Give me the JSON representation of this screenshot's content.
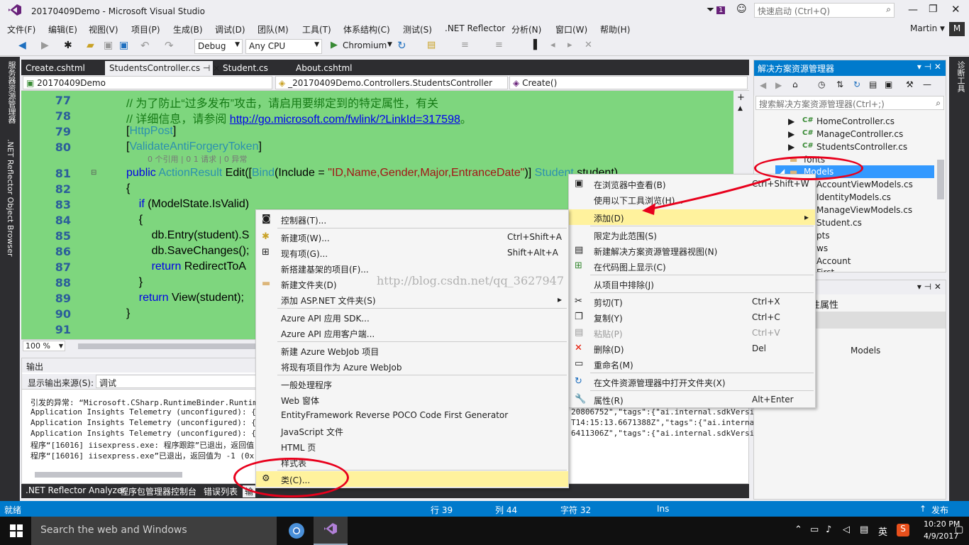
{
  "window": {
    "title": "20170409Demo - Microsoft Visual Studio",
    "notif_count": "1",
    "quick_launch": "快速启动 (Ctrl+Q)",
    "user": "Martin",
    "user_initial": "M"
  },
  "menu": [
    "文件(F)",
    "编辑(E)",
    "视图(V)",
    "项目(P)",
    "生成(B)",
    "调试(D)",
    "团队(M)",
    "工具(T)",
    "体系结构(C)",
    "测试(S)",
    ".NET Reflector",
    "分析(N)",
    "窗口(W)",
    "帮助(H)"
  ],
  "toolbar": {
    "config": "Debug",
    "platform": "Any CPU",
    "run": "Chromium"
  },
  "left_strip": [
    "服务器资源管理器",
    ".NET Reflector Object Browser"
  ],
  "right_strip": [
    "诊断工具"
  ],
  "tabs": [
    "Create.cshtml",
    "StudentsController.cs",
    "Student.cs",
    "About.cshtml"
  ],
  "tab_pin": "⊣ ×",
  "nav": {
    "project": "20170409Demo",
    "class": "_20170409Demo.Controllers.StudentsController",
    "member": "Create()"
  },
  "code": {
    "lines": [
      {
        "n": "77",
        "a": "// 为了防止“过多发布”攻击，请启用要绑定到的特定属性，有关"
      },
      {
        "n": "78",
        "a": "// 详细信息，请参阅 ",
        "link": "http://go.microsoft.com/fwlink/?LinkId=317598",
        "b": "。"
      },
      {
        "n": "79",
        "attr": "HttpPost"
      },
      {
        "n": "80",
        "attr": "ValidateAntiForgeryToken"
      },
      {
        "n": "81"
      },
      {
        "n": "82",
        "a": "{"
      },
      {
        "n": "83"
      },
      {
        "n": "84",
        "a": "    {"
      },
      {
        "n": "85",
        "a": "        db.Entry(student).S"
      },
      {
        "n": "86",
        "a": "        db.SaveChanges();"
      },
      {
        "n": "87"
      },
      {
        "n": "88",
        "a": "    }"
      },
      {
        "n": "89"
      },
      {
        "n": "90",
        "a": "}"
      },
      {
        "n": "91",
        "a": ""
      }
    ],
    "lens": "0 个引用 | 0 1 请求 | 0 异常",
    "l81_public": "public ",
    "l81_type": "ActionResult",
    "l81_rest": " Edit([",
    "l81_bind": "Bind",
    "l81_inc": "(Include = ",
    "l81_str": "\"ID,Name,Gender,Major,EntranceDate\"",
    "l81_end": ")] ",
    "l81_stype": "Student",
    "l81_arg": " student)",
    "l83_if": "if",
    "l83_rest": " (ModelState.IsValid)",
    "l87_ret": "return",
    "l87_rest": " RedirectToA",
    "l89_ret": "return",
    "l89_rest": " View(student);",
    "brackets": [
      "[",
      "]",
      "[",
      "]"
    ]
  },
  "zoom": "100 %",
  "output": {
    "title": "输出",
    "source_label": "显示输出来源(S):",
    "source_value": "调试",
    "lines": [
      "引发的异常: “Microsoft.CSharp.RuntimeBinder.RuntimeBi",
      "Application Insights Telemetry (unconfigured): {\"name",
      "Application Insights Telemetry (unconfigured): {\"name",
      "Application Insights Telemetry (unconfigured): {\"name",
      "程序“[16016] iisexpress.exe: 程序跟踪”已退出，返回值",
      "程序“[16016] iisexpress.exe”已退出，返回值为 -1 (0x"
    ],
    "right_lines": [
      "20806752\",\"tags\":{\"ai.internal.sdkVersi",
      "T14:15:13.6671388Z\",\"tags\":{\"ai.internal",
      "6411306Z\",\"tags\":{\"ai.internal.sdkVersi"
    ]
  },
  "bottom_tabs": [
    ".NET Reflector Analyzer",
    "程序包管理器控制台",
    "错误列表",
    "输"
  ],
  "solution": {
    "title": "解决方案资源管理器",
    "search": "搜索解决方案资源管理器(Ctrl+;)",
    "items": [
      {
        "label": "HomeController.cs"
      },
      {
        "label": "ManageController.cs"
      },
      {
        "label": "StudentsController.cs"
      },
      {
        "label": "fonts"
      },
      {
        "label": "Models"
      },
      {
        "label": "AccountViewModels.cs"
      },
      {
        "label": "IdentityModels.cs"
      },
      {
        "label": "ManageViewModels.cs"
      },
      {
        "label": "Student.cs"
      },
      {
        "label": "pts"
      },
      {
        "label": "ws"
      },
      {
        "label": "Account"
      },
      {
        "label": "First"
      }
    ],
    "cs_badge": "C#"
  },
  "properties": {
    "title_frag": "性属性",
    "value": "Models"
  },
  "ctx_main": [
    {
      "label": "在浏览器中查看(B)",
      "sc": "Ctrl+Shift+W"
    },
    {
      "label": "使用以下工具浏览(H)..."
    },
    {
      "label": "添加(D)",
      "arrow": "▸"
    },
    {
      "label": "限定为此范围(S)"
    },
    {
      "label": "新建解决方案资源管理器视图(N)"
    },
    {
      "label": "在代码图上显示(C)"
    },
    {
      "label": "从项目中排除(J)"
    },
    {
      "label": "剪切(T)",
      "sc": "Ctrl+X"
    },
    {
      "label": "复制(Y)",
      "sc": "Ctrl+C"
    },
    {
      "label": "粘贴(P)",
      "sc": "Ctrl+V"
    },
    {
      "label": "删除(D)",
      "sc": "Del"
    },
    {
      "label": "重命名(M)"
    },
    {
      "label": "在文件资源管理器中打开文件夹(X)"
    },
    {
      "label": "属性(R)",
      "sc": "Alt+Enter"
    }
  ],
  "ctx_sub": [
    {
      "label": "控制器(T)..."
    },
    {
      "label": "新建项(W)...",
      "sc": "Ctrl+Shift+A"
    },
    {
      "label": "现有项(G)...",
      "sc": "Shift+Alt+A"
    },
    {
      "label": "新搭建基架的项目(F)..."
    },
    {
      "label": "新建文件夹(D)"
    },
    {
      "label": "添加 ASP.NET 文件夹(S)",
      "arrow": "▸"
    },
    {
      "label": "Azure API 应用 SDK..."
    },
    {
      "label": "Azure API 应用客户端..."
    },
    {
      "label": "新建 Azure WebJob 项目"
    },
    {
      "label": "将现有项目作为 Azure WebJob"
    },
    {
      "label": "一般处理程序"
    },
    {
      "label": "Web 窗体"
    },
    {
      "label": "EntityFramework Reverse POCO Code First Generator"
    },
    {
      "label": "JavaScript 文件"
    },
    {
      "label": "HTML 页"
    },
    {
      "label": "样式表"
    },
    {
      "label": "类(C)..."
    }
  ],
  "watermark": "http://blog.csdn.net/qq_3627947",
  "status": {
    "ready": "就绪",
    "row": "行 39",
    "col": "列 44",
    "char": "字符 32",
    "mode": "Ins",
    "publish": "发布"
  },
  "taskbar": {
    "search": "Search the web and Windows",
    "ime": "英",
    "time": "10:20 PM",
    "date": "4/9/2017"
  },
  "colors": {
    "accent": "#007ACC",
    "highlight": "#FFF29D",
    "editor_bg": "#7ED67E",
    "annotation": "#E8001C"
  }
}
